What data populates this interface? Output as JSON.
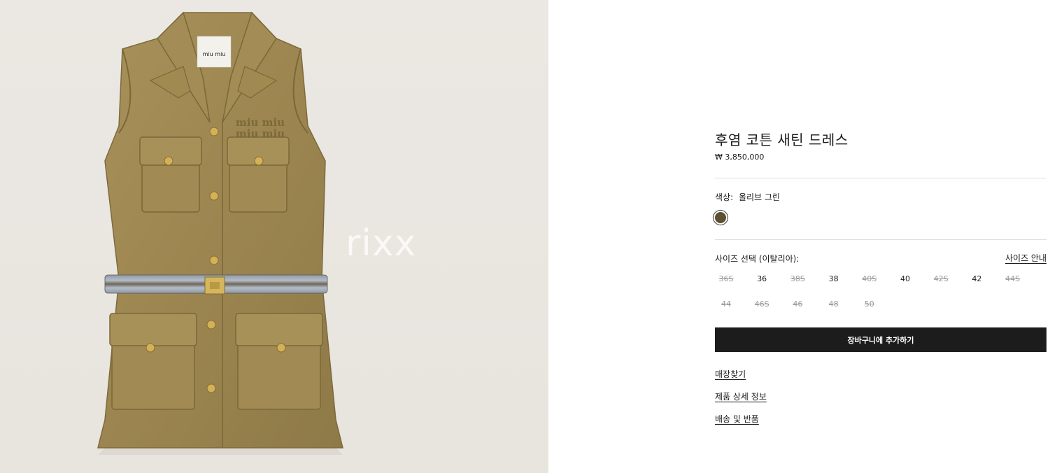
{
  "image": {
    "label_text": "miu miu",
    "embroidery_text": "miu miu",
    "watermark": "rixx"
  },
  "product": {
    "title": "후염 코튼 새틴 드레스",
    "price": "₩ 3,850,000"
  },
  "color": {
    "label": "색상:",
    "value": "올리브 그린",
    "swatch_color": "#5b5133"
  },
  "size": {
    "label": "사이즈 선택 (이탈리아):",
    "guide_label": "사이즈 안내",
    "options": [
      {
        "label": "36S",
        "available": false
      },
      {
        "label": "36",
        "available": true
      },
      {
        "label": "38S",
        "available": false
      },
      {
        "label": "38",
        "available": true
      },
      {
        "label": "40S",
        "available": false
      },
      {
        "label": "40",
        "available": true
      },
      {
        "label": "42S",
        "available": false
      },
      {
        "label": "42",
        "available": true
      },
      {
        "label": "44S",
        "available": false
      },
      {
        "label": "44",
        "available": false
      },
      {
        "label": "46S",
        "available": false
      },
      {
        "label": "46",
        "available": false
      },
      {
        "label": "48",
        "available": false
      },
      {
        "label": "50",
        "available": false
      }
    ]
  },
  "actions": {
    "add_to_cart": "장바구니에 추가하기"
  },
  "links": {
    "store_finder": "매장찾기",
    "product_details": "제품 상세 정보",
    "shipping_returns": "배송 및 반품"
  }
}
